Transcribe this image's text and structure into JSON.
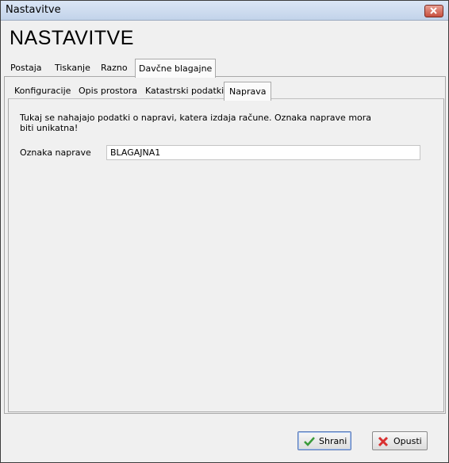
{
  "window": {
    "title": "Nastavitve"
  },
  "header": {
    "title": "NASTAVITVE"
  },
  "outer_tabs": [
    {
      "label": "Postaja"
    },
    {
      "label": "Tiskanje"
    },
    {
      "label": "Razno"
    },
    {
      "label": "Davčne blagajne",
      "active": true
    }
  ],
  "inner_tabs": [
    {
      "label": "Konfiguracije"
    },
    {
      "label": "Opis prostora"
    },
    {
      "label": "Katastrski podatki"
    },
    {
      "label": "Naprava",
      "active": true
    }
  ],
  "content": {
    "description": "Tukaj se nahajajo podatki o napravi, katera izdaja račune. Oznaka naprave mora\nbiti unikatna!",
    "device_label": "Oznaka naprave",
    "device_value": "BLAGAJNA1"
  },
  "footer": {
    "save_label": "Shrani",
    "cancel_label": "Opusti"
  },
  "icons": {
    "save": "check-icon",
    "cancel": "x-icon",
    "close": "close-icon"
  },
  "colors": {
    "titlebar": "#c2d3ea",
    "window_bg": "#f0f0f0",
    "check_green": "#3a9a3a",
    "x_red": "#d93030"
  }
}
